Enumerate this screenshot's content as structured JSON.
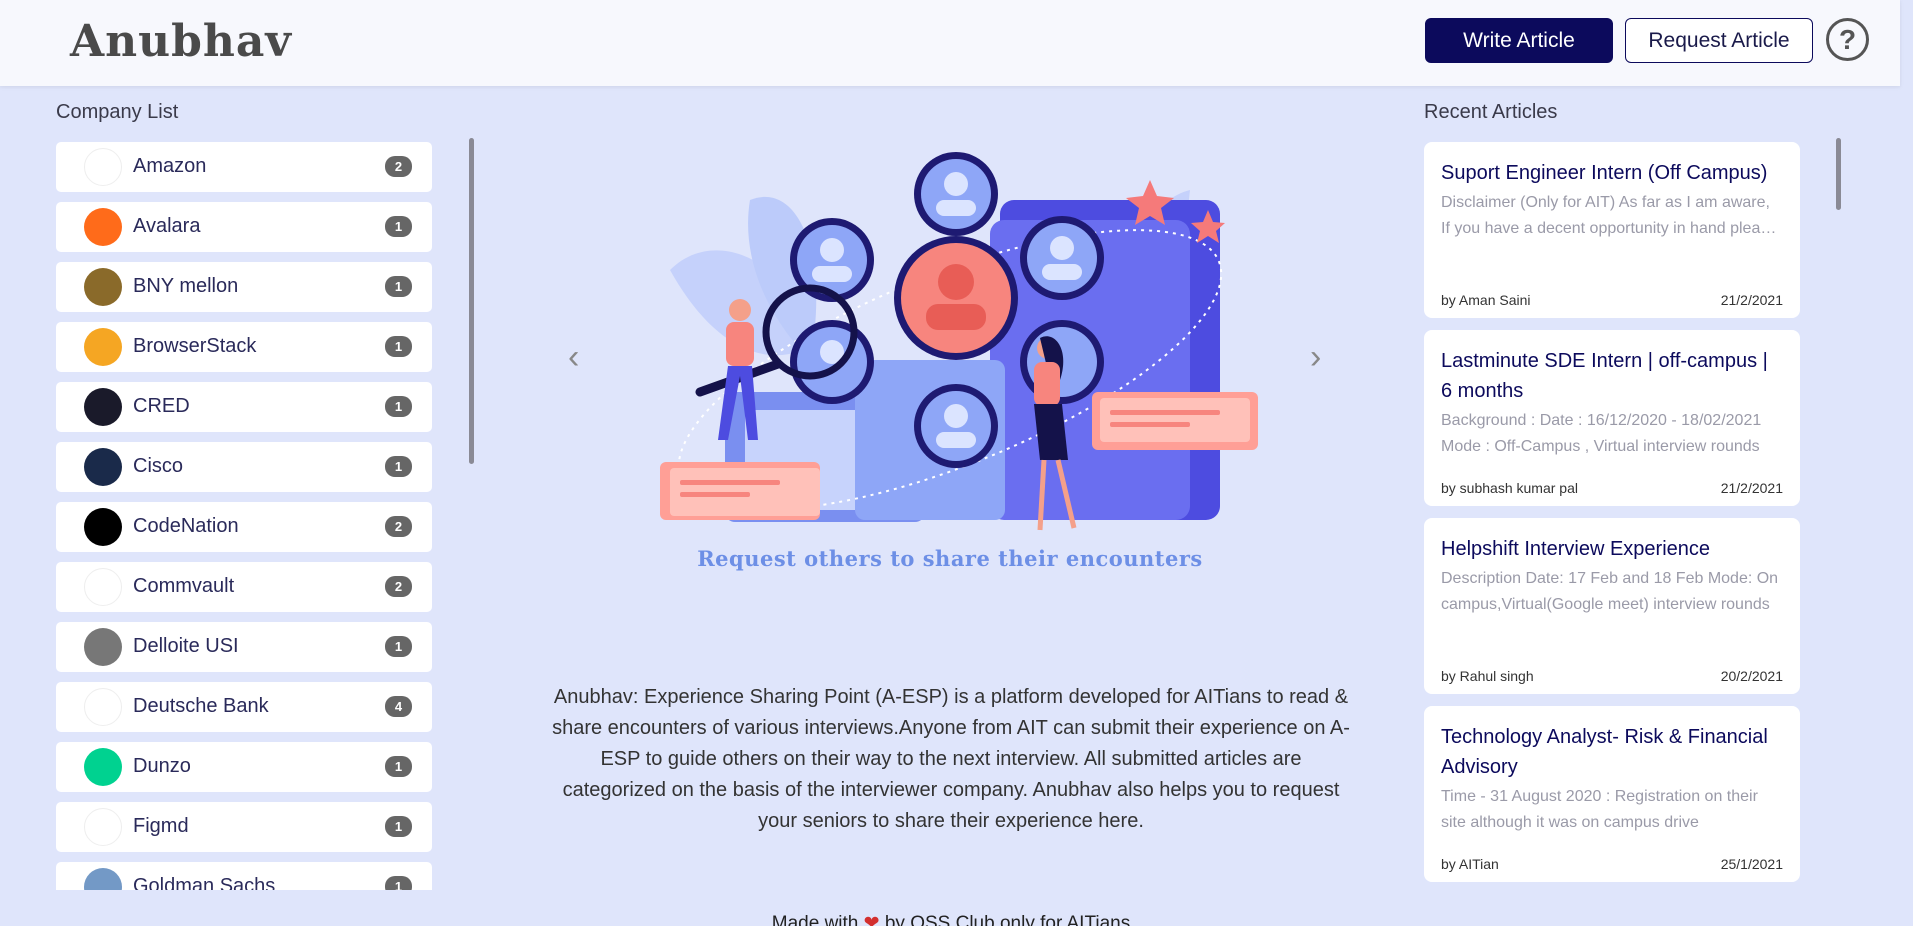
{
  "header": {
    "logo": "Anubhav",
    "write_label": "Write Article",
    "request_label": "Request Article",
    "help_icon": "?"
  },
  "companies": {
    "title": "Company List",
    "items": [
      {
        "name": "Amazon",
        "count": "2",
        "icon": "amazon-logo",
        "color": "#ffffff"
      },
      {
        "name": "Avalara",
        "count": "1",
        "icon": "avalara-logo",
        "color": "#ff6b1a"
      },
      {
        "name": "BNY mellon",
        "count": "1",
        "icon": "bny-mellon-logo",
        "color": "#8a6a2a"
      },
      {
        "name": "BrowserStack",
        "count": "1",
        "icon": "browserstack-logo",
        "color": "#f5a623"
      },
      {
        "name": "CRED",
        "count": "1",
        "icon": "cred-logo",
        "color": "#1a1a2a"
      },
      {
        "name": "Cisco",
        "count": "1",
        "icon": "cisco-logo",
        "color": "#1a2a4a"
      },
      {
        "name": "CodeNation",
        "count": "2",
        "icon": "codenation-logo",
        "color": "#000000"
      },
      {
        "name": "Commvault",
        "count": "2",
        "icon": "commvault-logo",
        "color": "#ffffff"
      },
      {
        "name": "Delloite USI",
        "count": "1",
        "icon": "deloitte-logo",
        "color": "#777777"
      },
      {
        "name": "Deutsche Bank",
        "count": "4",
        "icon": "deutsche-bank-logo",
        "color": "#ffffff"
      },
      {
        "name": "Dunzo",
        "count": "1",
        "icon": "dunzo-logo",
        "color": "#00d290"
      },
      {
        "name": "Figmd",
        "count": "1",
        "icon": "figmd-logo",
        "color": "#ffffff"
      },
      {
        "name": "Goldman Sachs",
        "count": "1",
        "icon": "goldman-sachs-logo",
        "color": "#7399c6"
      }
    ]
  },
  "hero": {
    "caption": "Request others to share their encounters",
    "prev_icon": "‹",
    "next_icon": "›"
  },
  "about": "Anubhav: Experience Sharing Point (A-ESP) is a platform developed for AITians to read & share encounters of various interviews.Anyone from AIT can submit their experience on A-ESP to guide others on their way to the next interview. All submitted articles are categorized on the basis of the interviewer company. Anubhav also helps you to request your seniors to share their experience here.",
  "footer": {
    "before": "Made with",
    "heart": "❤",
    "after": "by OSS Club only for AITians"
  },
  "articles": {
    "title": "Recent Articles",
    "items": [
      {
        "title": "Suport Engineer Intern (Off Campus)",
        "excerpt": "Disclaimer (Only for AIT) As far as I am aware, If you have a decent opportunity in hand please do not waste your time.",
        "author": "by Aman Saini",
        "date": "21/2/2021"
      },
      {
        "title": "Lastminute SDE Intern | off-campus | 6 months",
        "excerpt": "Background : Date : 16/12/2020 - 18/02/2021 Mode : Off-Campus , Virtual interview rounds",
        "author": "by subhash kumar pal",
        "date": "21/2/2021"
      },
      {
        "title": "Helpshift Interview Experience",
        "excerpt": "Description Date: 17 Feb and 18 Feb Mode: On campus,Virtual(Google meet) interview rounds",
        "author": "by Rahul singh",
        "date": "20/2/2021"
      },
      {
        "title": "Technology Analyst- Risk & Financial Advisory",
        "excerpt": "Time - 31 August 2020 : Registration on their site although it was on campus drive",
        "author": "by AITian",
        "date": "25/1/2021"
      }
    ]
  }
}
